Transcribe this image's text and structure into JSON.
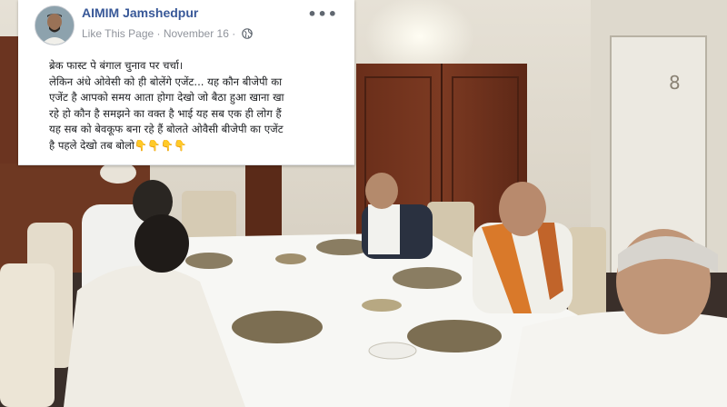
{
  "post": {
    "page_name": "AIMIM Jamshedpur",
    "like_label": "Like This Page",
    "separator": " · ",
    "date": "November 16",
    "separator2": " · ",
    "more_label": "•••",
    "text_lines": [
      "ब्रेक फास्ट पे बंगाल चुनाव पर चर्चा।",
      "लेकिन अंधे ओवेसी को ही बोलेंगे एजेंट... यह कौन बीजेपी का",
      "एजेंट है आपको समय आता होगा देखो जो बैठा हुआ खाना खा",
      "रहे हो कौन है समझने का वक्त है भाई यह सब एक ही लोग हैं",
      "यह सब को बेवकूफ बना रहे हैं बोलते ओवैसी बीजेपी का एजेंट",
      "है पहले देखो तब बोलो👇👇👇👇"
    ]
  },
  "photo": {
    "door_number": "8"
  },
  "colors": {
    "link": "#385898",
    "meta": "#90949c",
    "text": "#1c1e21",
    "tablecloth": "#f7f7f4",
    "saffron_scarf": "#d9792a"
  },
  "icons": {
    "privacy": "globe-icon",
    "menu": "more-options-icon"
  }
}
